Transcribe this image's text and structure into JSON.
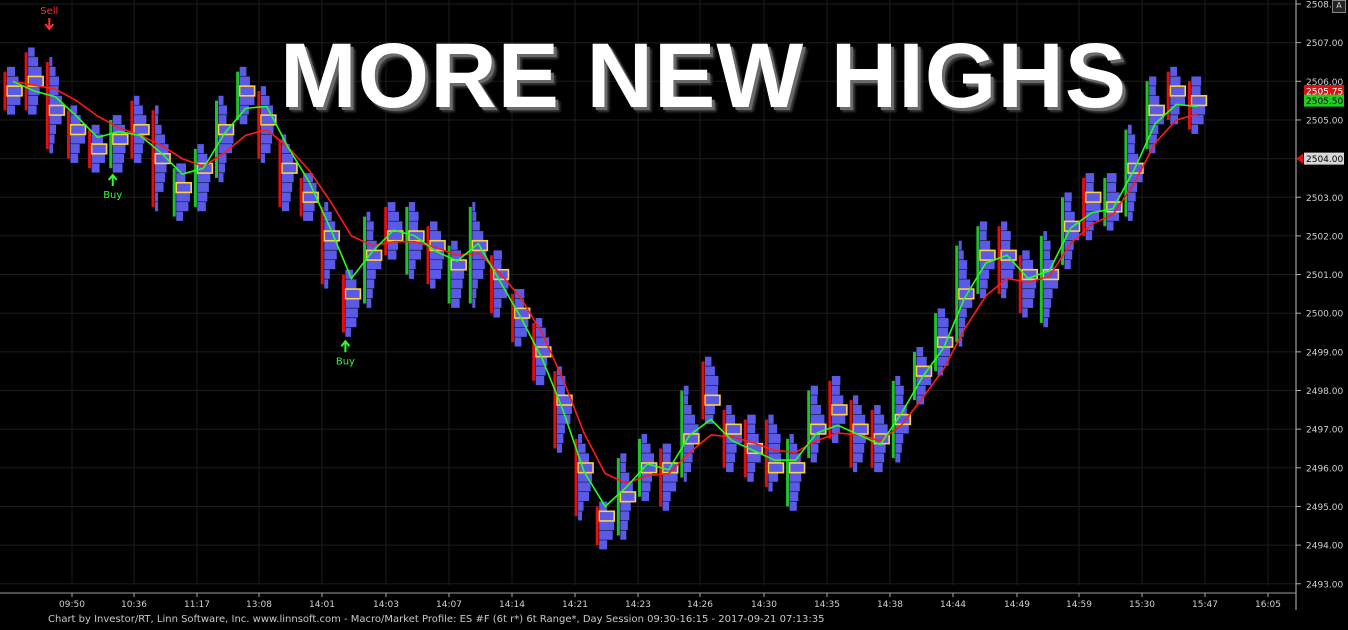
{
  "headline": "MORE NEW HIGHS",
  "footer": "Chart by Investor/RT, Linn Software, Inc. www.linnsoft.com - Macro/Market Profile: ES #F (6t r*) 6t Range*, Day Session 09:30-16:15 - 2017-09-21 07:13:35",
  "corner_button": "A",
  "colors": {
    "background": "#000000",
    "up": "#22c02a",
    "down": "#e01010",
    "profile": "#5a5ae6",
    "fast_ma": "#22ff22",
    "slow_ma": "#ff1a1a",
    "poc": "#ffd23f",
    "grid": "#1c1c1c"
  },
  "chart_data": {
    "type": "candlestick",
    "title": "",
    "grid": true,
    "ylim": [
      2493.0,
      2508.0
    ],
    "y_ticks": [
      "2493.00",
      "2494.00",
      "2495.00",
      "2496.00",
      "2497.00",
      "2498.00",
      "2499.00",
      "2500.00",
      "2501.00",
      "2502.00",
      "2503.00",
      "2504.00",
      "2505.00",
      "2506.00",
      "2507.00",
      "2508.00"
    ],
    "x_tick_labels": [
      "09:50",
      "10:36",
      "11:17",
      "13:08",
      "14:01",
      "14:03",
      "14:07",
      "14:14",
      "14:21",
      "14:23",
      "14:26",
      "14:30",
      "14:35",
      "14:38",
      "14:44",
      "14:49",
      "14:59",
      "15:30",
      "15:47",
      "16:05"
    ],
    "price_labels": {
      "last": "2505.75",
      "fast": "2505.50",
      "marker": "2504.00"
    },
    "signals": [
      {
        "label": "Sell",
        "bar": 2,
        "price": 2507.8
      },
      {
        "label": "Buy",
        "bar": 5,
        "price": 2503.6
      },
      {
        "label": "Buy",
        "bar": 16,
        "price": 2499.3
      }
    ],
    "bars": [
      [
        2505.75,
        2506.25,
        2505.25,
        2505.5
      ],
      [
        2506.25,
        2506.75,
        2505.25,
        2505.5
      ],
      [
        2505.5,
        2506.5,
        2504.25,
        2505.0
      ],
      [
        2505.0,
        2505.25,
        2504.0,
        2504.25
      ],
      [
        2504.25,
        2504.75,
        2503.75,
        2504.0
      ],
      [
        2504.0,
        2505.0,
        2503.75,
        2505.0
      ],
      [
        2505.0,
        2505.5,
        2504.0,
        2504.25
      ],
      [
        2505.0,
        2505.25,
        2502.75,
        2503.0
      ],
      [
        2503.0,
        2503.75,
        2502.5,
        2503.5
      ],
      [
        2503.5,
        2504.25,
        2502.75,
        2503.75
      ],
      [
        2503.75,
        2505.5,
        2503.5,
        2505.5
      ],
      [
        2505.5,
        2506.25,
        2505.0,
        2505.75
      ],
      [
        2505.75,
        2505.75,
        2504.0,
        2504.25
      ],
      [
        2504.25,
        2504.5,
        2502.75,
        2503.0
      ],
      [
        2503.0,
        2503.5,
        2502.5,
        2502.75
      ],
      [
        2502.75,
        2502.75,
        2500.75,
        2501.25
      ],
      [
        2501.0,
        2501.0,
        2499.5,
        2499.75
      ],
      [
        2500.5,
        2502.5,
        2500.25,
        2502.5
      ],
      [
        2502.5,
        2502.75,
        2501.5,
        2501.5
      ],
      [
        2501.5,
        2502.75,
        2501.0,
        2502.5
      ],
      [
        2502.25,
        2502.25,
        2500.75,
        2501.0
      ],
      [
        2501.0,
        2501.75,
        2500.25,
        2501.25
      ],
      [
        2501.0,
        2502.75,
        2500.25,
        2502.25
      ],
      [
        2501.5,
        2501.5,
        2500.0,
        2500.25
      ],
      [
        2500.25,
        2500.5,
        2499.25,
        2499.5
      ],
      [
        2499.5,
        2499.75,
        2498.25,
        2498.5
      ],
      [
        2498.5,
        2498.5,
        2496.5,
        2496.75
      ],
      [
        2496.75,
        2496.75,
        2494.75,
        2495.0
      ],
      [
        2495.0,
        2495.0,
        2494.0,
        2494.25
      ],
      [
        2494.25,
        2496.25,
        2494.25,
        2496.0
      ],
      [
        2495.25,
        2496.75,
        2495.25,
        2496.5
      ],
      [
        2496.5,
        2496.5,
        2495.0,
        2495.5
      ],
      [
        2495.75,
        2498.0,
        2495.75,
        2497.75
      ],
      [
        2498.0,
        2498.75,
        2497.25,
        2497.5
      ],
      [
        2497.5,
        2497.5,
        2496.0,
        2496.25
      ],
      [
        2496.5,
        2497.25,
        2495.75,
        2496.25
      ],
      [
        2496.25,
        2497.25,
        2495.5,
        2495.75
      ],
      [
        2495.75,
        2496.75,
        2495.0,
        2496.25
      ],
      [
        2496.25,
        2498.0,
        2496.25,
        2497.75
      ],
      [
        2497.75,
        2498.25,
        2496.75,
        2497.0
      ],
      [
        2497.0,
        2497.75,
        2496.0,
        2496.75
      ],
      [
        2496.75,
        2497.5,
        2496.0,
        2496.5
      ],
      [
        2496.5,
        2498.25,
        2496.25,
        2498.0
      ],
      [
        2498.25,
        2499.0,
        2497.75,
        2498.75
      ],
      [
        2498.75,
        2500.0,
        2498.5,
        2499.5
      ],
      [
        2499.5,
        2501.75,
        2499.25,
        2501.25
      ],
      [
        2501.25,
        2502.25,
        2500.5,
        2501.75
      ],
      [
        2501.75,
        2502.25,
        2500.5,
        2501.25
      ],
      [
        2501.25,
        2501.5,
        2500.0,
        2500.5
      ],
      [
        2500.5,
        2502.0,
        2499.75,
        2501.5
      ],
      [
        2501.5,
        2503.0,
        2501.25,
        2502.75
      ],
      [
        2503.5,
        2503.5,
        2502.0,
        2502.5
      ],
      [
        2502.5,
        2503.5,
        2502.25,
        2502.75
      ],
      [
        2502.75,
        2504.75,
        2502.5,
        2504.5
      ],
      [
        2504.5,
        2506.0,
        2504.25,
        2505.75
      ],
      [
        2506.0,
        2506.25,
        2505.0,
        2505.25
      ],
      [
        2505.75,
        2506.0,
        2504.75,
        2505.25
      ]
    ],
    "fast_ma": [
      2506.0,
      2505.75,
      2505.6,
      2505.1,
      2504.55,
      2504.7,
      2504.6,
      2504.15,
      2503.6,
      2503.75,
      2504.65,
      2505.3,
      2505.35,
      2504.3,
      2503.4,
      2502.2,
      2500.9,
      2501.6,
      2502.15,
      2502.0,
      2501.6,
      2501.35,
      2501.8,
      2500.85,
      2499.9,
      2498.85,
      2497.5,
      2495.9,
      2495.0,
      2495.5,
      2496.1,
      2495.95,
      2496.85,
      2497.25,
      2496.7,
      2496.45,
      2496.2,
      2496.2,
      2496.9,
      2497.1,
      2496.85,
      2496.6,
      2497.4,
      2498.35,
      2499.1,
      2500.4,
      2501.3,
      2501.5,
      2500.9,
      2501.1,
      2502.2,
      2502.6,
      2502.7,
      2503.7,
      2504.9,
      2505.4,
      2505.35
    ],
    "slow_ma": [
      2506.0,
      2505.9,
      2505.8,
      2505.5,
      2505.1,
      2504.8,
      2504.6,
      2504.35,
      2504.0,
      2503.8,
      2504.15,
      2504.6,
      2504.75,
      2504.3,
      2503.7,
      2502.9,
      2502.0,
      2501.75,
      2501.85,
      2501.85,
      2501.7,
      2501.5,
      2501.55,
      2501.05,
      2500.4,
      2499.5,
      2498.3,
      2496.9,
      2495.85,
      2495.6,
      2495.8,
      2495.85,
      2496.4,
      2496.85,
      2496.8,
      2496.65,
      2496.45,
      2496.4,
      2496.7,
      2496.9,
      2496.85,
      2496.7,
      2497.1,
      2497.8,
      2498.55,
      2499.6,
      2500.45,
      2500.9,
      2500.8,
      2500.95,
      2501.8,
      2502.3,
      2502.55,
      2503.35,
      2504.4,
      2505.0,
      2505.15
    ]
  }
}
